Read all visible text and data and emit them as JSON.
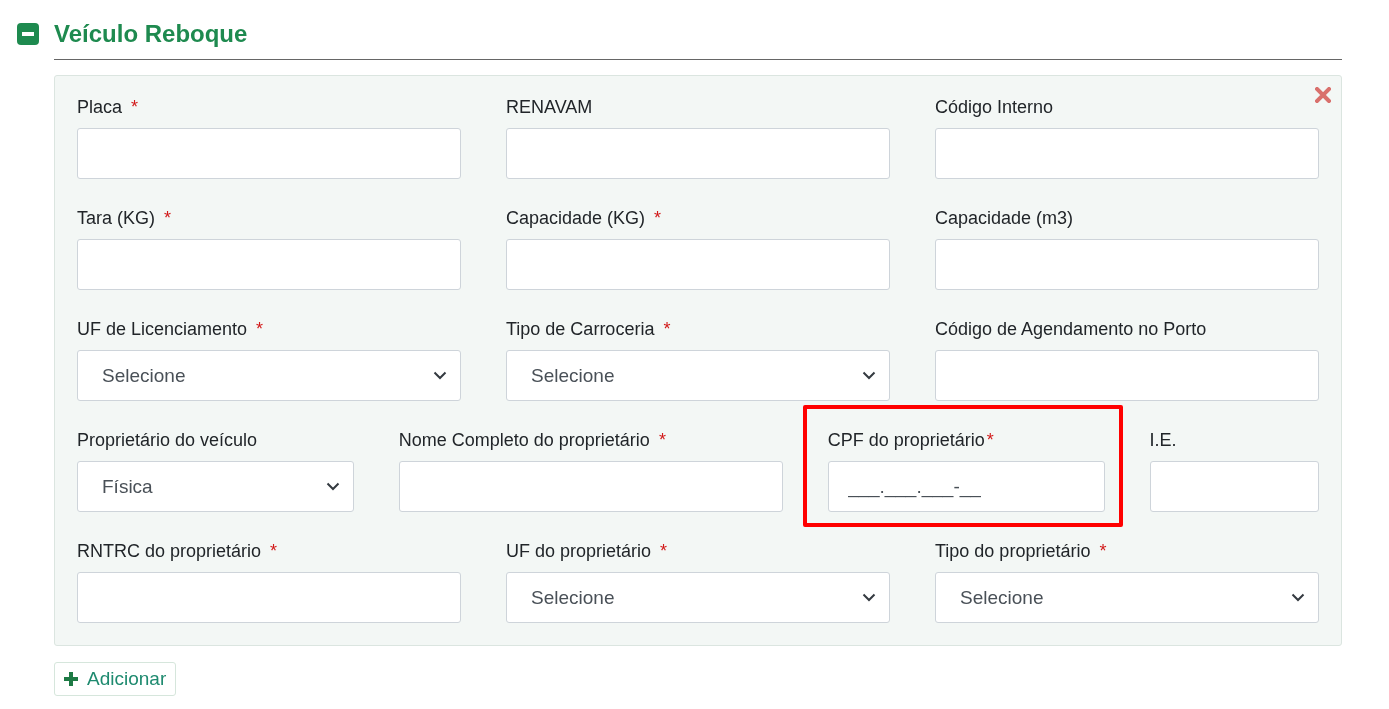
{
  "section": {
    "title": "Veículo Reboque",
    "expanded": true
  },
  "rows": [
    [
      {
        "label": "Placa",
        "required_mark": "*",
        "kind": "text"
      },
      {
        "label": "RENAVAM",
        "kind": "text"
      },
      {
        "label": "Código Interno",
        "kind": "text"
      }
    ],
    [
      {
        "label": "Tara (KG)",
        "required_mark": "*",
        "kind": "text"
      },
      {
        "label": "Capacidade (KG)",
        "required_mark": "*",
        "kind": "text"
      },
      {
        "label": "Capacidade (m3)",
        "kind": "text"
      }
    ],
    [
      {
        "label": "UF de Licenciamento",
        "required_mark": "*",
        "kind": "select",
        "value": "Selecione"
      },
      {
        "label": "Tipo de Carroceria",
        "required_mark": "*",
        "kind": "select",
        "value": "Selecione"
      },
      {
        "label": "Código de Agendamento no Porto",
        "kind": "text"
      }
    ],
    [
      {
        "label": "Proprietário do veículo",
        "kind": "select",
        "value": "Física"
      },
      {
        "label": "Nome Completo do proprietário",
        "required_mark": "*",
        "kind": "text"
      },
      {
        "label": "CPF do proprietário",
        "required_mark": "*",
        "kind": "text",
        "placeholder": "___.___.___-__",
        "highlighted": true
      },
      {
        "label": "I.E.",
        "kind": "text"
      }
    ],
    [
      {
        "label": "RNTRC do proprietário",
        "required_mark": "*",
        "kind": "text"
      },
      {
        "label": "UF do proprietário",
        "required_mark": "*",
        "kind": "select",
        "value": "Selecione"
      },
      {
        "label": "Tipo do proprietário",
        "required_mark": "*",
        "kind": "select",
        "value": "Selecione"
      }
    ]
  ],
  "add_button": "Adicionar"
}
